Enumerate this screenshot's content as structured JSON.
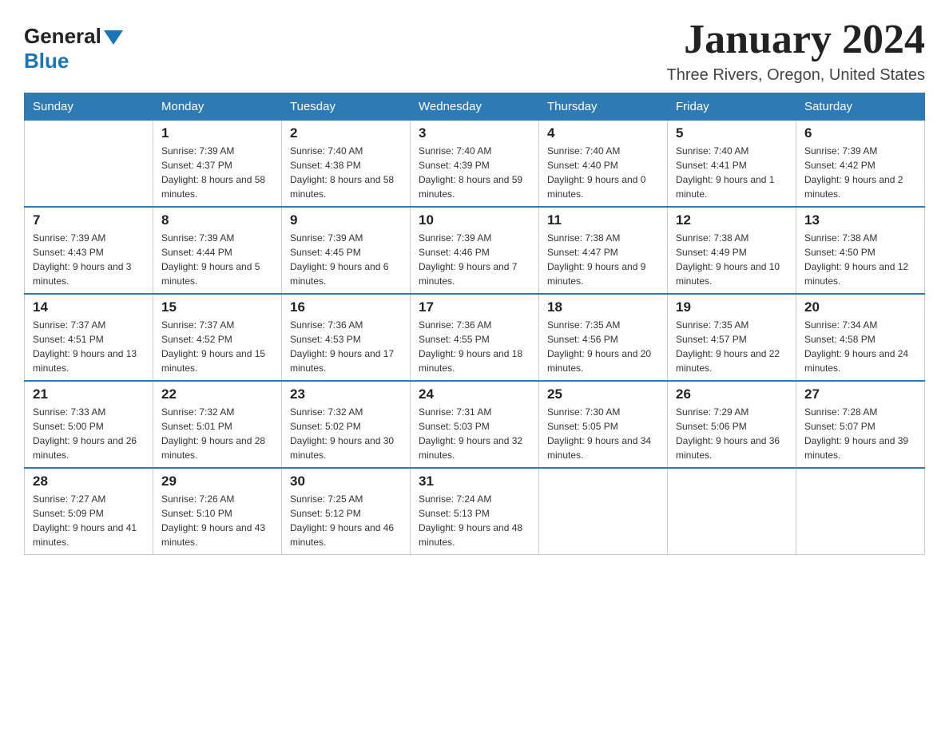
{
  "logo": {
    "general": "General",
    "blue": "Blue"
  },
  "title": "January 2024",
  "location": "Three Rivers, Oregon, United States",
  "days_of_week": [
    "Sunday",
    "Monday",
    "Tuesday",
    "Wednesday",
    "Thursday",
    "Friday",
    "Saturday"
  ],
  "weeks": [
    [
      {
        "num": "",
        "sunrise": "",
        "sunset": "",
        "daylight": ""
      },
      {
        "num": "1",
        "sunrise": "Sunrise: 7:39 AM",
        "sunset": "Sunset: 4:37 PM",
        "daylight": "Daylight: 8 hours and 58 minutes."
      },
      {
        "num": "2",
        "sunrise": "Sunrise: 7:40 AM",
        "sunset": "Sunset: 4:38 PM",
        "daylight": "Daylight: 8 hours and 58 minutes."
      },
      {
        "num": "3",
        "sunrise": "Sunrise: 7:40 AM",
        "sunset": "Sunset: 4:39 PM",
        "daylight": "Daylight: 8 hours and 59 minutes."
      },
      {
        "num": "4",
        "sunrise": "Sunrise: 7:40 AM",
        "sunset": "Sunset: 4:40 PM",
        "daylight": "Daylight: 9 hours and 0 minutes."
      },
      {
        "num": "5",
        "sunrise": "Sunrise: 7:40 AM",
        "sunset": "Sunset: 4:41 PM",
        "daylight": "Daylight: 9 hours and 1 minute."
      },
      {
        "num": "6",
        "sunrise": "Sunrise: 7:39 AM",
        "sunset": "Sunset: 4:42 PM",
        "daylight": "Daylight: 9 hours and 2 minutes."
      }
    ],
    [
      {
        "num": "7",
        "sunrise": "Sunrise: 7:39 AM",
        "sunset": "Sunset: 4:43 PM",
        "daylight": "Daylight: 9 hours and 3 minutes."
      },
      {
        "num": "8",
        "sunrise": "Sunrise: 7:39 AM",
        "sunset": "Sunset: 4:44 PM",
        "daylight": "Daylight: 9 hours and 5 minutes."
      },
      {
        "num": "9",
        "sunrise": "Sunrise: 7:39 AM",
        "sunset": "Sunset: 4:45 PM",
        "daylight": "Daylight: 9 hours and 6 minutes."
      },
      {
        "num": "10",
        "sunrise": "Sunrise: 7:39 AM",
        "sunset": "Sunset: 4:46 PM",
        "daylight": "Daylight: 9 hours and 7 minutes."
      },
      {
        "num": "11",
        "sunrise": "Sunrise: 7:38 AM",
        "sunset": "Sunset: 4:47 PM",
        "daylight": "Daylight: 9 hours and 9 minutes."
      },
      {
        "num": "12",
        "sunrise": "Sunrise: 7:38 AM",
        "sunset": "Sunset: 4:49 PM",
        "daylight": "Daylight: 9 hours and 10 minutes."
      },
      {
        "num": "13",
        "sunrise": "Sunrise: 7:38 AM",
        "sunset": "Sunset: 4:50 PM",
        "daylight": "Daylight: 9 hours and 12 minutes."
      }
    ],
    [
      {
        "num": "14",
        "sunrise": "Sunrise: 7:37 AM",
        "sunset": "Sunset: 4:51 PM",
        "daylight": "Daylight: 9 hours and 13 minutes."
      },
      {
        "num": "15",
        "sunrise": "Sunrise: 7:37 AM",
        "sunset": "Sunset: 4:52 PM",
        "daylight": "Daylight: 9 hours and 15 minutes."
      },
      {
        "num": "16",
        "sunrise": "Sunrise: 7:36 AM",
        "sunset": "Sunset: 4:53 PM",
        "daylight": "Daylight: 9 hours and 17 minutes."
      },
      {
        "num": "17",
        "sunrise": "Sunrise: 7:36 AM",
        "sunset": "Sunset: 4:55 PM",
        "daylight": "Daylight: 9 hours and 18 minutes."
      },
      {
        "num": "18",
        "sunrise": "Sunrise: 7:35 AM",
        "sunset": "Sunset: 4:56 PM",
        "daylight": "Daylight: 9 hours and 20 minutes."
      },
      {
        "num": "19",
        "sunrise": "Sunrise: 7:35 AM",
        "sunset": "Sunset: 4:57 PM",
        "daylight": "Daylight: 9 hours and 22 minutes."
      },
      {
        "num": "20",
        "sunrise": "Sunrise: 7:34 AM",
        "sunset": "Sunset: 4:58 PM",
        "daylight": "Daylight: 9 hours and 24 minutes."
      }
    ],
    [
      {
        "num": "21",
        "sunrise": "Sunrise: 7:33 AM",
        "sunset": "Sunset: 5:00 PM",
        "daylight": "Daylight: 9 hours and 26 minutes."
      },
      {
        "num": "22",
        "sunrise": "Sunrise: 7:32 AM",
        "sunset": "Sunset: 5:01 PM",
        "daylight": "Daylight: 9 hours and 28 minutes."
      },
      {
        "num": "23",
        "sunrise": "Sunrise: 7:32 AM",
        "sunset": "Sunset: 5:02 PM",
        "daylight": "Daylight: 9 hours and 30 minutes."
      },
      {
        "num": "24",
        "sunrise": "Sunrise: 7:31 AM",
        "sunset": "Sunset: 5:03 PM",
        "daylight": "Daylight: 9 hours and 32 minutes."
      },
      {
        "num": "25",
        "sunrise": "Sunrise: 7:30 AM",
        "sunset": "Sunset: 5:05 PM",
        "daylight": "Daylight: 9 hours and 34 minutes."
      },
      {
        "num": "26",
        "sunrise": "Sunrise: 7:29 AM",
        "sunset": "Sunset: 5:06 PM",
        "daylight": "Daylight: 9 hours and 36 minutes."
      },
      {
        "num": "27",
        "sunrise": "Sunrise: 7:28 AM",
        "sunset": "Sunset: 5:07 PM",
        "daylight": "Daylight: 9 hours and 39 minutes."
      }
    ],
    [
      {
        "num": "28",
        "sunrise": "Sunrise: 7:27 AM",
        "sunset": "Sunset: 5:09 PM",
        "daylight": "Daylight: 9 hours and 41 minutes."
      },
      {
        "num": "29",
        "sunrise": "Sunrise: 7:26 AM",
        "sunset": "Sunset: 5:10 PM",
        "daylight": "Daylight: 9 hours and 43 minutes."
      },
      {
        "num": "30",
        "sunrise": "Sunrise: 7:25 AM",
        "sunset": "Sunset: 5:12 PM",
        "daylight": "Daylight: 9 hours and 46 minutes."
      },
      {
        "num": "31",
        "sunrise": "Sunrise: 7:24 AM",
        "sunset": "Sunset: 5:13 PM",
        "daylight": "Daylight: 9 hours and 48 minutes."
      },
      {
        "num": "",
        "sunrise": "",
        "sunset": "",
        "daylight": ""
      },
      {
        "num": "",
        "sunrise": "",
        "sunset": "",
        "daylight": ""
      },
      {
        "num": "",
        "sunrise": "",
        "sunset": "",
        "daylight": ""
      }
    ]
  ]
}
